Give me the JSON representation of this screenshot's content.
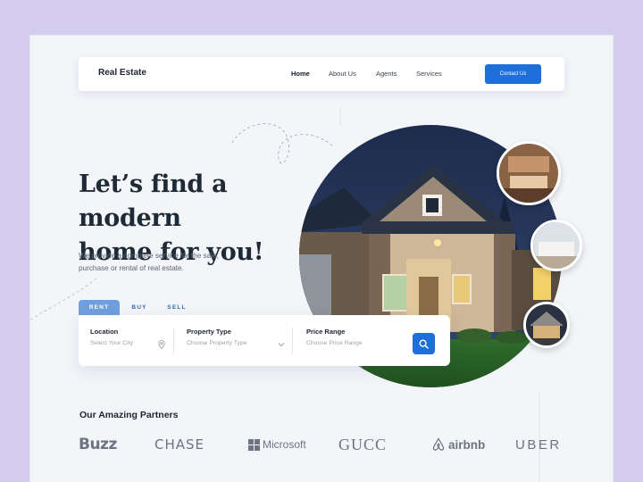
{
  "nav": {
    "brand": "Real Estate",
    "links": [
      "Home",
      "About Us",
      "Agents",
      "Services"
    ],
    "cta": "Contact Us"
  },
  "hero": {
    "title_line1": "Let’s find a modern",
    "title_line2": "home for you!",
    "description_line1": "We provide a complete service for the sale,",
    "description_line2": "purchase or rental of real estate."
  },
  "search": {
    "tabs": [
      "RENT",
      "BUY",
      "SELL"
    ],
    "active_tab": "RENT",
    "fields": [
      {
        "label": "Location",
        "placeholder": "Select Your City",
        "icon": "map-pin-icon"
      },
      {
        "label": "Property Type",
        "placeholder": "Choose Property Type",
        "icon": "chevron-down-icon"
      },
      {
        "label": "Price Range",
        "placeholder": "Choose Price Range",
        "icon": ""
      }
    ],
    "button_icon": "search-icon"
  },
  "partners": {
    "title": "Our Amazing Partners",
    "logos": [
      "Buzz",
      "CHASE",
      "Microsoft",
      "GUCC",
      "airbnb",
      "UBER"
    ]
  },
  "colors": {
    "page_bg": "#d4cdef",
    "frame_bg": "#f3f5f9",
    "accent": "#1e6fd9",
    "active_tab": "#6f9fdc",
    "text_dark": "#1f2a37"
  }
}
